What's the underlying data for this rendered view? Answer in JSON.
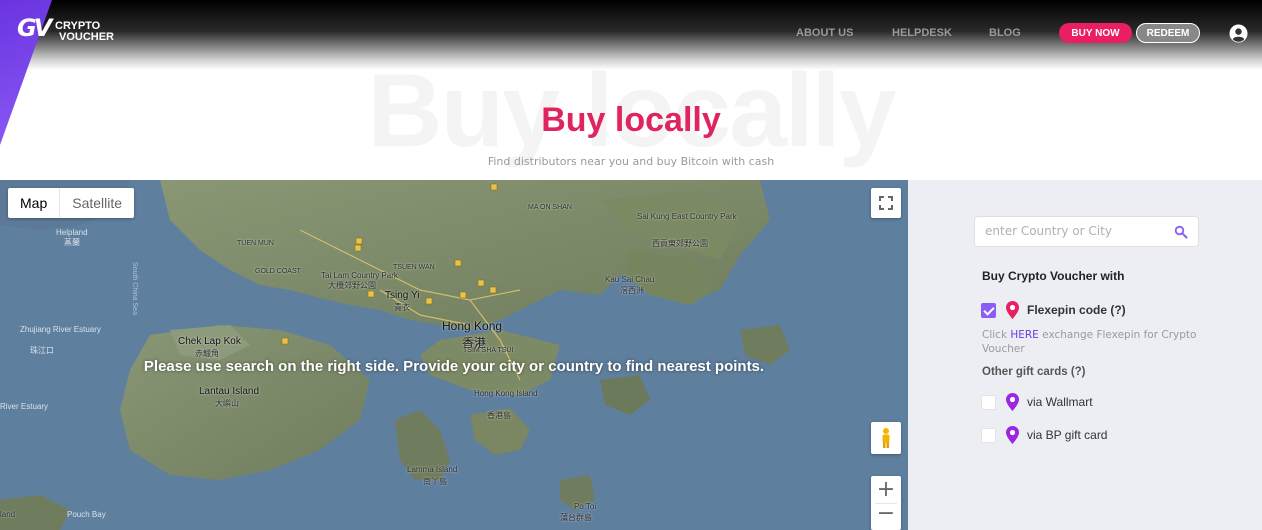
{
  "brand": {
    "logo_mark": "GV",
    "line1": "CRYPTO",
    "line2": "VOUCHER"
  },
  "nav": {
    "about": "ABOUT US",
    "helpdesk": "HELPDESK",
    "blog": "BLOG",
    "buy_now": "BUY NOW",
    "redeem": "REDEEM",
    "user_icon": "user-circle-icon"
  },
  "hero": {
    "background_word": "Buy locally",
    "title": "Buy locally",
    "subtitle": "Find distributors near you and buy Bitcoin with cash"
  },
  "map": {
    "type_map": "Map",
    "type_satellite": "Satellite",
    "overlay_message": "Please use search on the right side. Provide your city or country to find nearest points.",
    "zoom_in": "+",
    "zoom_out": "−",
    "labels": {
      "hong_kong": "Hong Kong",
      "hong_kong_zh": "香港",
      "chek_lap_kok": "Chek Lap Kok",
      "chek_lap_kok_zh": "赤鱲角",
      "lantau": "Lantau Island",
      "lantau_zh": "大嶼山",
      "hk_island": "Hong Kong Island",
      "hk_island_zh": "香港島",
      "lamma": "Lamma Island",
      "lamma_zh": "南丫島",
      "tsing_yi": "Tsing Yi",
      "tsing_yi_zh": "青衣",
      "tai_lam": "Tai Lam Country Park",
      "tai_lam_zh": "大欖郊野公園",
      "sai_kung": "Sai Kung East Country Park",
      "sai_kung_zh": "西貢東郊野公園",
      "kau_sai_chau": "Kau Sai Chau",
      "kau_sai_chau_zh": "滘西洲",
      "zhujiang": "Zhujiang River Estuary",
      "zhujiang_zh": "珠江口",
      "po_toi": "Po Toi",
      "po_toi_zh": "蒲台群島",
      "pouch_bay": "Pouch Bay",
      "river_estuary": "River Estuary",
      "south_china_sea": "South China Sea",
      "tsim_sha_tsui": "TSIM SHA TSUI",
      "helpland": "Helpland",
      "helpland_zh": "蒸蘭",
      "gold_coast": "GOLD COAST",
      "tuen_mun": "TUEN MUN",
      "ma_on_shan": "MA ON SHAN",
      "tsuen_wan": "TSUEN WAN",
      "island_bottom": "land"
    }
  },
  "sidebar": {
    "search_placeholder": "enter Country or City",
    "heading": "Buy Crypto Voucher with",
    "flexepin": "Flexepin code (?)",
    "note_prefix": "Click ",
    "note_link": "HERE",
    "note_suffix": " exchange Flexepin for Crypto Voucher",
    "other_heading": "Other gift cards (?)",
    "wallmart": "via Wallmart",
    "bp": "via BP gift card",
    "flexepin_checked": true,
    "wallmart_checked": false,
    "bp_checked": false,
    "colors": {
      "flexepin_pin": "#e91e63",
      "other_pin": "#9b27e0",
      "accent": "#8b5cf6"
    }
  }
}
